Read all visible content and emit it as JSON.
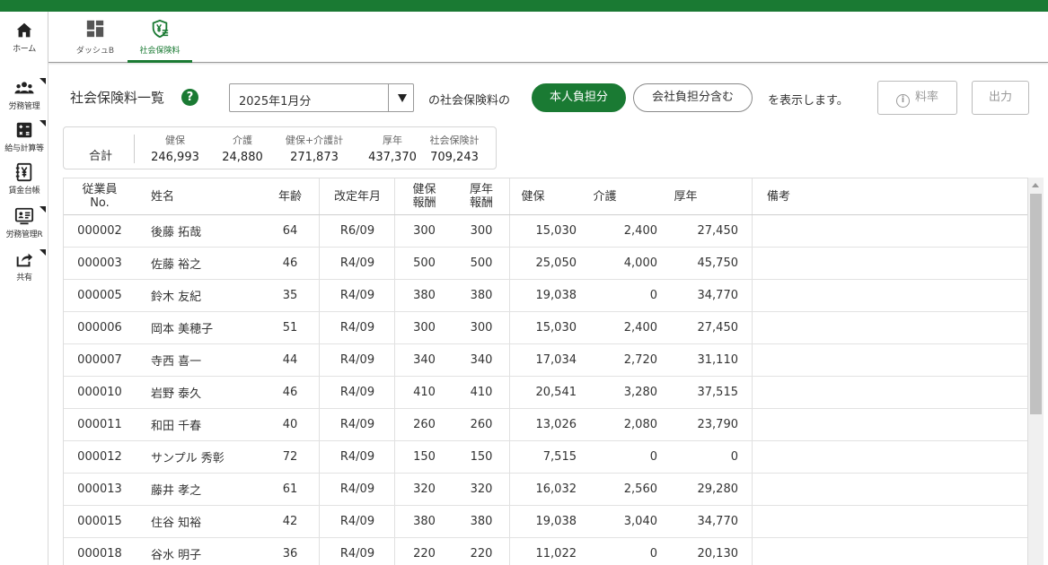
{
  "rail": [
    {
      "key": "home",
      "label": "ホーム",
      "icon": "home-icon",
      "menu": false
    },
    {
      "key": "labor",
      "label": "労務管理",
      "icon": "people-icon",
      "menu": true
    },
    {
      "key": "payroll",
      "label": "給与計算等",
      "icon": "calculator-icon",
      "menu": true
    },
    {
      "key": "ledger",
      "label": "賃金台帳",
      "icon": "yen-ledger-icon",
      "menu": false
    },
    {
      "key": "laborR",
      "label": "労務管理R",
      "icon": "id-card-icon",
      "menu": true
    },
    {
      "key": "share",
      "label": "共有",
      "icon": "share-icon",
      "menu": true
    }
  ],
  "tabs": [
    {
      "label": "ダッシュB",
      "icon": "dashboard-icon",
      "active": false
    },
    {
      "label": "社会保険料",
      "icon": "shield-yen-icon",
      "active": true
    }
  ],
  "toolbar": {
    "title": "社会保険料一覧",
    "help": "?",
    "period": "2025年1月分",
    "phrase1": "の社会保険料の",
    "opt_self": "本人負担分",
    "opt_company": "会社負担分含む",
    "phrase2": "を表示します。",
    "rate_label": "料率",
    "output_label": "出力"
  },
  "summary": {
    "label": "合計",
    "cols": [
      {
        "h": "健保",
        "v": "246,993"
      },
      {
        "h": "介護",
        "v": "24,880"
      },
      {
        "h": "健保+介護計",
        "v": "271,873"
      },
      {
        "h": "厚年",
        "v": "437,370"
      },
      {
        "h": "社会保険計",
        "v": "709,243"
      }
    ]
  },
  "table": {
    "headers": {
      "no_1": "従業員",
      "no_2": "No.",
      "name": "姓名",
      "age": "年齢",
      "revised": "改定年月",
      "hk_1": "健保",
      "hk_2": "報酬",
      "kn_1": "厚年",
      "kn_2": "報酬",
      "health": "健保",
      "care": "介護",
      "pension": "厚年",
      "notes": "備考"
    },
    "rows": [
      {
        "no": "000002",
        "name": "後藤 拓哉",
        "age": "64",
        "revised": "R6/09",
        "hk": "300",
        "kn": "300",
        "health": "15,030",
        "care": "2,400",
        "pension": "27,450"
      },
      {
        "no": "000003",
        "name": "佐藤 裕之",
        "age": "46",
        "revised": "R4/09",
        "hk": "500",
        "kn": "500",
        "health": "25,050",
        "care": "4,000",
        "pension": "45,750"
      },
      {
        "no": "000005",
        "name": "鈴木 友紀",
        "age": "35",
        "revised": "R4/09",
        "hk": "380",
        "kn": "380",
        "health": "19,038",
        "care": "0",
        "pension": "34,770"
      },
      {
        "no": "000006",
        "name": "岡本 美穂子",
        "age": "51",
        "revised": "R4/09",
        "hk": "300",
        "kn": "300",
        "health": "15,030",
        "care": "2,400",
        "pension": "27,450"
      },
      {
        "no": "000007",
        "name": "寺西 喜一",
        "age": "44",
        "revised": "R4/09",
        "hk": "340",
        "kn": "340",
        "health": "17,034",
        "care": "2,720",
        "pension": "31,110"
      },
      {
        "no": "000010",
        "name": "岩野 泰久",
        "age": "46",
        "revised": "R4/09",
        "hk": "410",
        "kn": "410",
        "health": "20,541",
        "care": "3,280",
        "pension": "37,515"
      },
      {
        "no": "000011",
        "name": "和田 千春",
        "age": "40",
        "revised": "R4/09",
        "hk": "260",
        "kn": "260",
        "health": "13,026",
        "care": "2,080",
        "pension": "23,790"
      },
      {
        "no": "000012",
        "name": "サンプル 秀彰",
        "age": "72",
        "revised": "R4/09",
        "hk": "150",
        "kn": "150",
        "health": "7,515",
        "care": "0",
        "pension": "0"
      },
      {
        "no": "000013",
        "name": "藤井 孝之",
        "age": "61",
        "revised": "R4/09",
        "hk": "320",
        "kn": "320",
        "health": "16,032",
        "care": "2,560",
        "pension": "29,280"
      },
      {
        "no": "000015",
        "name": "住谷 知裕",
        "age": "42",
        "revised": "R4/09",
        "hk": "380",
        "kn": "380",
        "health": "19,038",
        "care": "3,040",
        "pension": "34,770"
      },
      {
        "no": "000018",
        "name": "谷水 明子",
        "age": "36",
        "revised": "R4/09",
        "hk": "220",
        "kn": "220",
        "health": "11,022",
        "care": "0",
        "pension": "20,130"
      }
    ]
  },
  "colors": {
    "brand": "#1a7a33"
  }
}
